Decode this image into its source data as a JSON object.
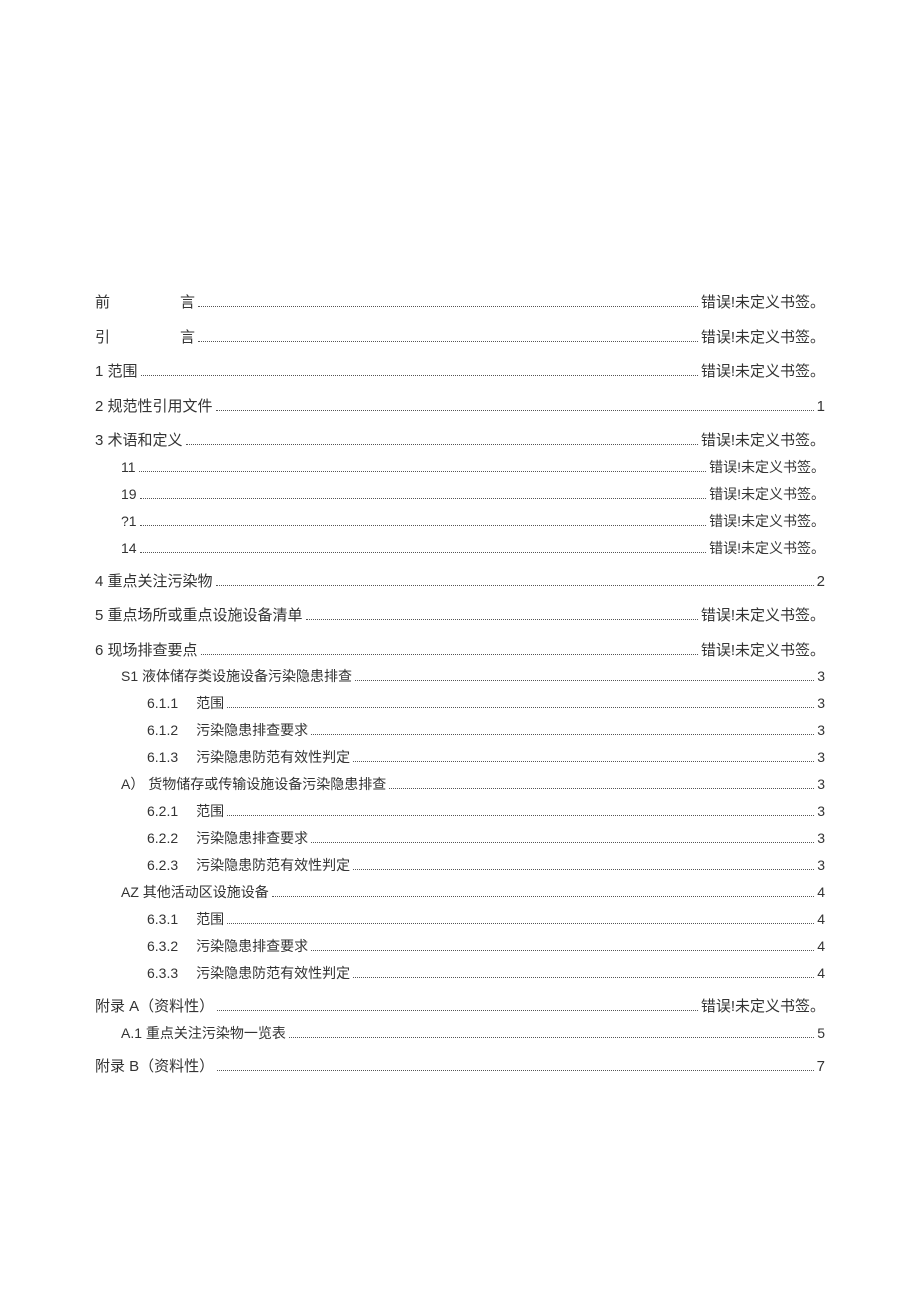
{
  "toc": {
    "e1": {
      "label": "前",
      "title": "言",
      "page": "错误!未定义书签。"
    },
    "e2": {
      "label": "引",
      "title": "言",
      "page": "错误!未定义书签。"
    },
    "e3": {
      "label": "1 范围",
      "page": "错误!未定义书签。"
    },
    "e4": {
      "label": "2 规范性引用文件",
      "page": "1"
    },
    "e5": {
      "label": "3 术语和定义",
      "page": "错误!未定义书签。"
    },
    "e5_1": {
      "label": "11",
      "page": "错误!未定义书签。"
    },
    "e5_2": {
      "label": "19",
      "page": "错误!未定义书签。"
    },
    "e5_3": {
      "label": "?1",
      "page": "错误!未定义书签。"
    },
    "e5_4": {
      "label": "14",
      "page": "错误!未定义书签。"
    },
    "e6": {
      "label": "4 重点关注污染物",
      "page": "2"
    },
    "e7": {
      "label": "5 重点场所或重点设施设备清单",
      "page": "错误!未定义书签。"
    },
    "e8": {
      "label": "6 现场排查要点",
      "page": "错误!未定义书签。"
    },
    "e8_1": {
      "label": "S1 液体储存类设施设备污染隐患排查",
      "page": "3"
    },
    "e8_1_1": {
      "num": "6.1.1",
      "title": "范围",
      "page": "3"
    },
    "e8_1_2": {
      "num": "6.1.2",
      "title": "污染隐患排查要求",
      "page": "3"
    },
    "e8_1_3": {
      "num": "6.1.3",
      "title": "污染隐患防范有效性判定",
      "page": "3"
    },
    "e8_2": {
      "label": "A） 货物储存或传输设施设备污染隐患排查",
      "page": "3"
    },
    "e8_2_1": {
      "num": "6.2.1",
      "title": "范围",
      "page": "3"
    },
    "e8_2_2": {
      "num": "6.2.2",
      "title": "污染隐患排查要求",
      "page": "3"
    },
    "e8_2_3": {
      "num": "6.2.3",
      "title": "污染隐患防范有效性判定",
      "page": "3"
    },
    "e8_3": {
      "label": "AZ 其他活动区设施设备",
      "page": "4"
    },
    "e8_3_1": {
      "num": "6.3.1",
      "title": "范围",
      "page": "4"
    },
    "e8_3_2": {
      "num": "6.3.2",
      "title": "污染隐患排查要求",
      "page": "4"
    },
    "e8_3_3": {
      "num": "6.3.3",
      "title": "污染隐患防范有效性判定",
      "page": "4"
    },
    "e9": {
      "label": "附录 A（资料性）",
      "page": "错误!未定义书签。"
    },
    "e9_1": {
      "label": "A.1 重点关注污染物一览表",
      "page": "5"
    },
    "e10": {
      "label": "附录 B（资料性）",
      "page": "7"
    }
  }
}
